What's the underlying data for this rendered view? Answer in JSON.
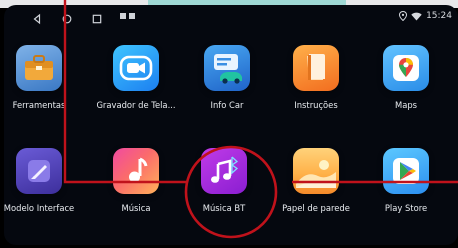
{
  "status_bar": {
    "time": "15:24",
    "nav_buttons": [
      "back",
      "home",
      "recent"
    ],
    "icons": [
      "location-icon",
      "wifi-icon"
    ]
  },
  "apps": [
    {
      "label": "Ferramentas",
      "icon": "toolbox-icon"
    },
    {
      "label": "Gravador de Tela...",
      "icon": "screen-recorder-icon"
    },
    {
      "label": "Info Car",
      "icon": "car-info-icon"
    },
    {
      "label": "Instruções",
      "icon": "book-icon"
    },
    {
      "label": "Maps",
      "icon": "maps-pin-icon"
    },
    {
      "label": "Modelo Interface",
      "icon": "paint-brush-icon"
    },
    {
      "label": "Música",
      "icon": "music-note-icon"
    },
    {
      "label": "Música BT",
      "icon": "bt-music-icon"
    },
    {
      "label": "Papel de parede",
      "icon": "wallpaper-icon"
    },
    {
      "label": "Play Store",
      "icon": "play-store-icon"
    }
  ],
  "colors": {
    "background": "#05080f",
    "highlight_circle": "#c0121b",
    "pointer_line": "#c0121b"
  }
}
